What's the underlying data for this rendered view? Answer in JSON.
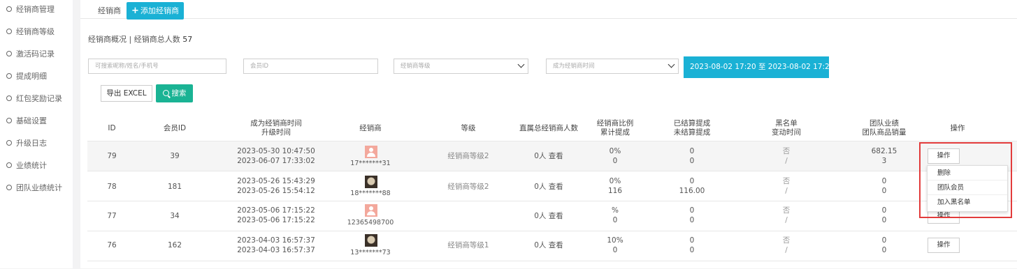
{
  "sidebar": {
    "items": [
      {
        "label": "经销商管理"
      },
      {
        "label": "经销商等级"
      },
      {
        "label": "激活码记录"
      },
      {
        "label": "提成明细"
      },
      {
        "label": "红包奖励记录"
      },
      {
        "label": "基础设置"
      },
      {
        "label": "升级日志"
      },
      {
        "label": "业绩统计"
      },
      {
        "label": "团队业绩统计"
      }
    ]
  },
  "tabs": {
    "plain": "经销商",
    "add": "添加经销商"
  },
  "summary": {
    "label": "经销商概况 | 经销商总人数",
    "count": "57"
  },
  "filters": {
    "keyword_placeholder": "可搜索昵称/姓名/手机号",
    "member_id_placeholder": "会员ID",
    "level_select": "经销商等级",
    "time_select": "成为经销商时间",
    "date_range": "2023-08-02 17:20 至 2023-08-02 17:20"
  },
  "actions": {
    "export": "导出 EXCEL",
    "search": "搜索"
  },
  "table": {
    "headers": {
      "id": "ID",
      "member_id": "会员ID",
      "time1": "成为经销商时间",
      "time2": "升级时间",
      "dealer": "经销商",
      "level": "等级",
      "direct": "直属总经销商人数",
      "ratio1": "经销商比例",
      "ratio2": "累计提成",
      "settled1": "已结算提成",
      "settled2": "未结算提成",
      "black1": "黑名单",
      "black2": "变动时间",
      "team1": "团队业绩",
      "team2": "团队商品销量",
      "op": "操作"
    },
    "rows": [
      {
        "id": "79",
        "member_id": "39",
        "time1": "2023-05-30 10:47:50",
        "time2": "2023-06-07 17:33:02",
        "avatar": "pink",
        "dealer": "17*******31",
        "level": "经销商等级2",
        "direct": "0人 查看",
        "ratio": "0%",
        "total": "0",
        "settled": "0",
        "unsettled": "0",
        "black": "否",
        "black_time": "/",
        "team_perf": "682.15",
        "team_sales": "3",
        "op": "操作"
      },
      {
        "id": "78",
        "member_id": "181",
        "time1": "2023-05-26 15:43:29",
        "time2": "2023-05-26 15:54:12",
        "avatar": "photo",
        "dealer": "18*******88",
        "level": "经销商等级2",
        "direct": "0人 查看",
        "ratio": "0%",
        "total": "116",
        "settled": "0",
        "unsettled": "116.00",
        "black": "否",
        "black_time": "/",
        "team_perf": "0",
        "team_sales": "0",
        "op": "操作"
      },
      {
        "id": "77",
        "member_id": "34",
        "time1": "2023-05-06 17:15:22",
        "time2": "2023-05-06 17:15:22",
        "avatar": "pink",
        "dealer": "12365498700",
        "level": "",
        "direct": "0人 查看",
        "ratio": "%",
        "total": "0",
        "settled": "0",
        "unsettled": "0",
        "black": "否",
        "black_time": "/",
        "team_perf": "0",
        "team_sales": "0",
        "op": "操作"
      },
      {
        "id": "76",
        "member_id": "162",
        "time1": "2023-04-03 16:57:37",
        "time2": "2023-04-03 16:57:37",
        "avatar": "photo",
        "dealer": "13*******73",
        "level": "经销商等级1",
        "direct": "0人 查看",
        "ratio": "10%",
        "total": "0",
        "settled": "0",
        "unsettled": "0",
        "black": "否",
        "black_time": "/",
        "team_perf": "0",
        "team_sales": "0",
        "op": "操作"
      }
    ]
  },
  "dropdown_menu": {
    "items": [
      "删除",
      "团队会员",
      "加入黑名单"
    ]
  },
  "colors": {
    "accent": "#1ab1d5",
    "search_green": "#1ab394",
    "highlight_red": "#e23b3b"
  }
}
